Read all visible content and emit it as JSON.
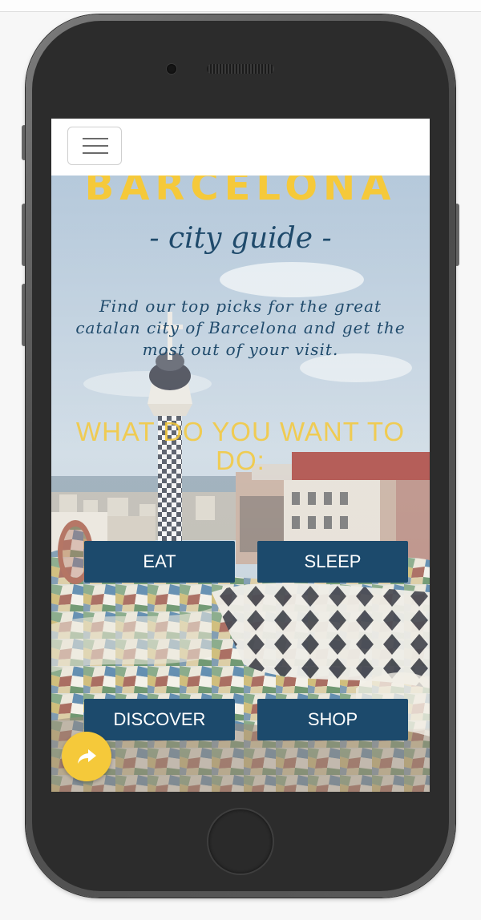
{
  "page": {
    "background": "#f7f7f7"
  },
  "nav": {
    "menu_icon": "hamburger-menu-icon"
  },
  "hero": {
    "title": "BARCELONA",
    "subtitle": "- city guide -",
    "intro": "Find our top picks for the great catalan city of Barcelona and get the most out of your visit.",
    "question": "WHAT DO YOU WANT TO DO:"
  },
  "categories": {
    "eat": "EAT",
    "sleep": "SLEEP",
    "discover": "DISCOVER",
    "shop": "SHOP"
  },
  "share": {
    "icon": "share-arrow-icon"
  },
  "colors": {
    "accent_yellow": "#f5c93a",
    "navy": "#1c4a6c",
    "text_navy": "#1f4a6b",
    "phone_body": "#2c2c2c"
  }
}
